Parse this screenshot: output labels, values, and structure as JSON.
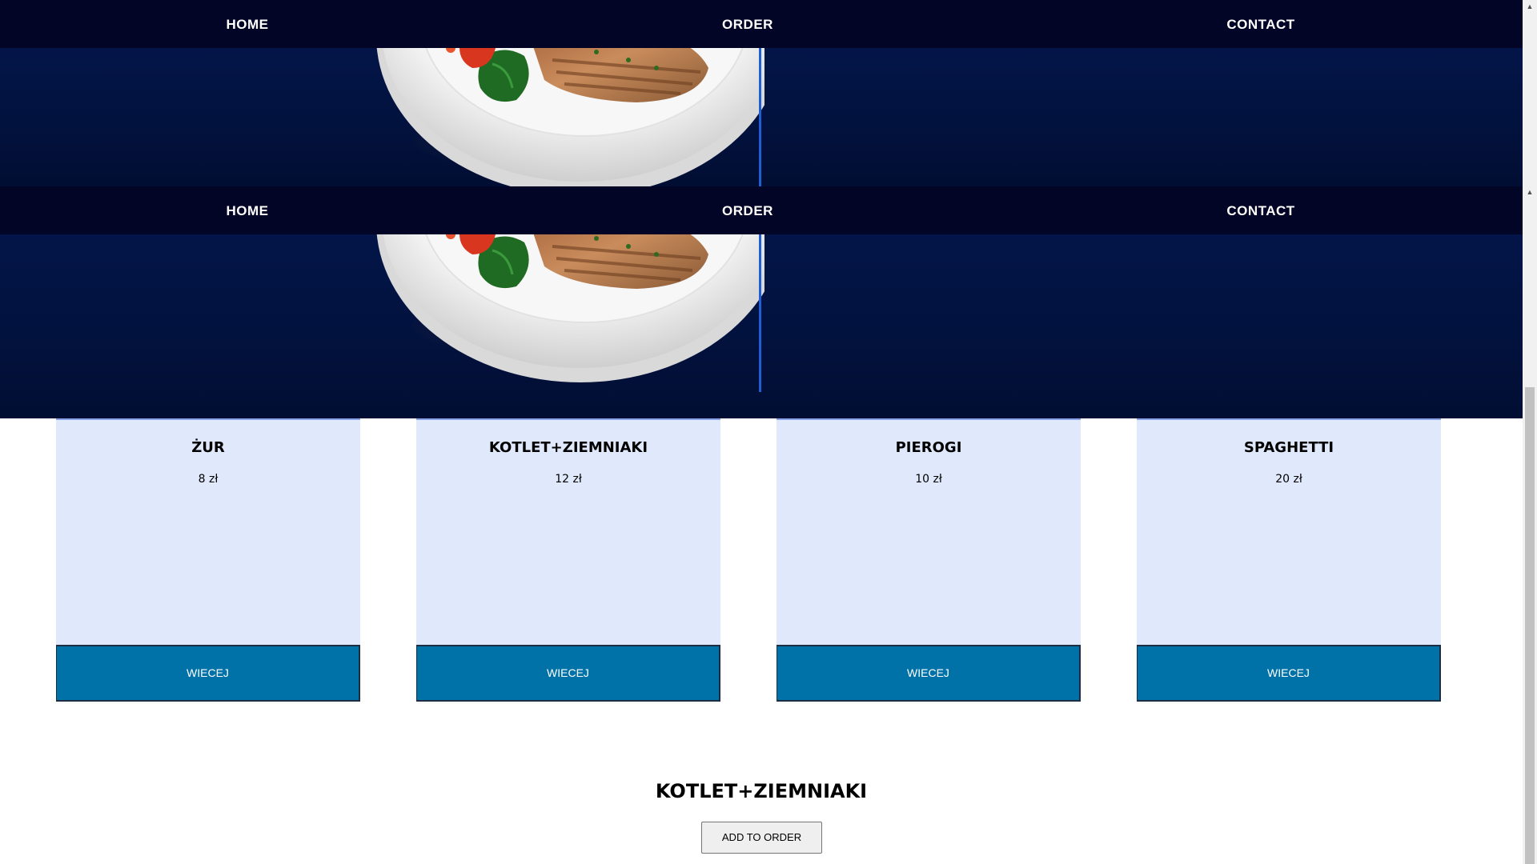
{
  "nav": {
    "home": "HOME",
    "order": "ORDER",
    "contact": "CONTACT"
  },
  "menu": [
    {
      "name": "ŻUR",
      "price": "8 zł",
      "button": "WIECEJ"
    },
    {
      "name": "KOTLET+ZIEMNIAKI",
      "price": "12 zł",
      "button": "WIECEJ"
    },
    {
      "name": "PIEROGI",
      "price": "10 zł",
      "button": "WIECEJ"
    },
    {
      "name": "SPAGHETTI",
      "price": "20 zł",
      "button": "WIECEJ"
    }
  ],
  "selected": {
    "title": "KOTLET+ZIEMNIAKI",
    "add_button": "ADD TO ORDER"
  },
  "colors": {
    "nav_bg": "#020526",
    "hero_bg": "#031548",
    "card_bg": "#e0e9fc",
    "button_bg": "#0072a8",
    "accent_line": "#1f5fd6"
  }
}
